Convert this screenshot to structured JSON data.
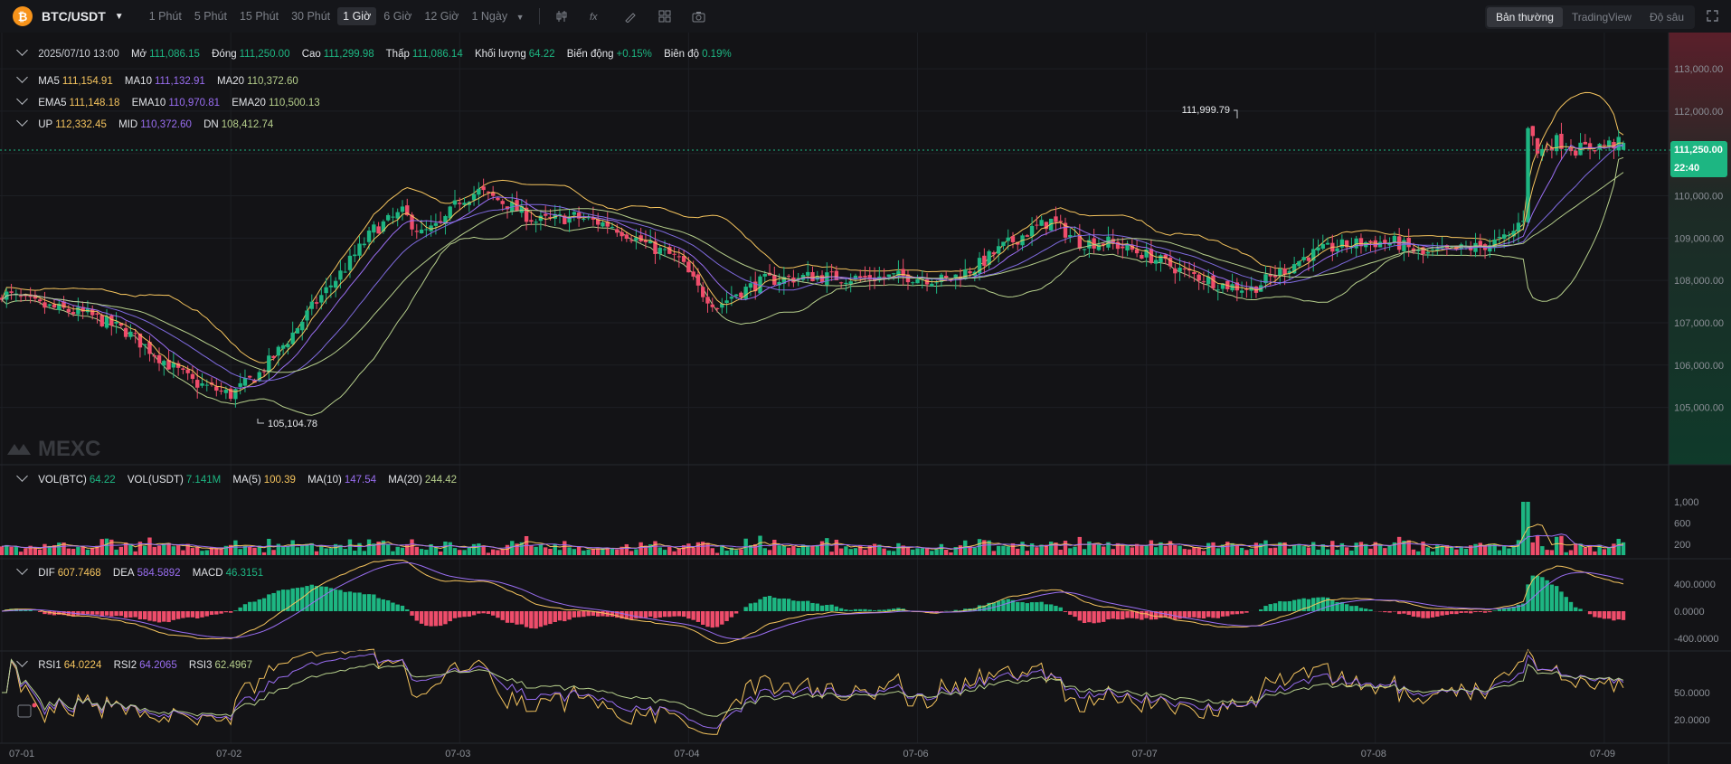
{
  "toolbar": {
    "coin_symbol": "₿",
    "pair": "BTC/USDT",
    "intervals": [
      "1 Phút",
      "5 Phút",
      "15 Phút",
      "30 Phút",
      "1 Giờ",
      "6 Giờ",
      "12 Giờ",
      "1 Ngày"
    ],
    "active_interval": "1 Giờ",
    "views": [
      "Bản thường",
      "TradingView",
      "Độ sâu"
    ],
    "active_view": "Bản thường",
    "icons": [
      "candle-settings-icon",
      "indicator-icon",
      "draw-icon",
      "layout-icon",
      "camera-icon",
      "fullscreen-icon"
    ]
  },
  "legend": {
    "ohlc": {
      "date": "2025/07/10 13:00",
      "open_label": "Mở",
      "open": "111,086.15",
      "close_label": "Đóng",
      "close": "111,250.00",
      "high_label": "Cao",
      "high": "111,299.98",
      "low_label": "Thấp",
      "low": "111,086.14",
      "vol_label": "Khối lượng",
      "vol": "64.22",
      "chg_label": "Biến động",
      "chg": "+0.15%",
      "amp_label": "Biên độ",
      "amp": "0.19%"
    },
    "ma": {
      "ma5_label": "MA5",
      "ma5": "111,154.91",
      "ma10_label": "MA10",
      "ma10": "111,132.91",
      "ma20_label": "MA20",
      "ma20": "110,372.60"
    },
    "ema": {
      "ema5_label": "EMA5",
      "ema5": "111,148.18",
      "ema10_label": "EMA10",
      "ema10": "110,970.81",
      "ema20_label": "EMA20",
      "ema20": "110,500.13"
    },
    "boll": {
      "up_label": "UP",
      "up": "112,332.45",
      "mid_label": "MID",
      "mid": "110,372.60",
      "dn_label": "DN",
      "dn": "108,412.74"
    },
    "vol": {
      "btc_label": "VOL(BTC)",
      "btc": "64.22",
      "usdt_label": "VOL(USDT)",
      "usdt": "7.141M",
      "ma5_label": "MA(5)",
      "ma5": "100.39",
      "ma10_label": "MA(10)",
      "ma10": "147.54",
      "ma20_label": "MA(20)",
      "ma20": "244.42"
    },
    "macd": {
      "dif_label": "DIF",
      "dif": "607.7468",
      "dea_label": "DEA",
      "dea": "584.5892",
      "macd_label": "MACD",
      "macd": "46.3151"
    },
    "rsi": {
      "rsi1_label": "RSI1",
      "rsi1": "64.0224",
      "rsi2_label": "RSI2",
      "rsi2": "64.2065",
      "rsi3_label": "RSI3",
      "rsi3": "62.4967"
    }
  },
  "watermark": "MEXC",
  "colors": {
    "up": "#1db682",
    "down": "#ef4d6b",
    "ma5": "#f5c45e",
    "ma10": "#9a6ef2",
    "ma20": "#b6cf8c",
    "price_tag": "#1db682"
  },
  "chart_data": {
    "type": "candlestick",
    "x_ticks": [
      "07-01",
      "07-02",
      "07-03",
      "07-04",
      "07-06",
      "07-07",
      "07-08",
      "07-09"
    ],
    "y_ticks": [
      "113,000.00",
      "112,000.00",
      "110,000.00",
      "109,000.00",
      "108,000.00",
      "107,000.00",
      "106,000.00",
      "105,000.00"
    ],
    "ylim": [
      104500,
      113600
    ],
    "high_marker": "111,999.79",
    "low_marker": "105,104.78",
    "last_price": "111,250.00",
    "countdown": "22:40",
    "price_path": [
      [
        0,
        107700
      ],
      [
        8,
        107400
      ],
      [
        18,
        107200
      ],
      [
        26,
        106800
      ],
      [
        34,
        106100
      ],
      [
        40,
        105600
      ],
      [
        48,
        105300
      ],
      [
        54,
        105800
      ],
      [
        60,
        106600
      ],
      [
        66,
        107500
      ],
      [
        72,
        108300
      ],
      [
        78,
        109200
      ],
      [
        84,
        109600
      ],
      [
        88,
        109100
      ],
      [
        92,
        109300
      ],
      [
        96,
        109900
      ],
      [
        100,
        110100
      ],
      [
        106,
        109800
      ],
      [
        112,
        109400
      ],
      [
        120,
        109500
      ],
      [
        128,
        109300
      ],
      [
        136,
        108800
      ],
      [
        142,
        108500
      ],
      [
        146,
        107800
      ],
      [
        150,
        107400
      ],
      [
        154,
        107700
      ],
      [
        160,
        108000
      ],
      [
        170,
        108100
      ],
      [
        180,
        108050
      ],
      [
        190,
        108100
      ],
      [
        198,
        108000
      ],
      [
        204,
        108300
      ],
      [
        210,
        108800
      ],
      [
        216,
        109200
      ],
      [
        220,
        109400
      ],
      [
        226,
        108900
      ],
      [
        232,
        108900
      ],
      [
        240,
        108600
      ],
      [
        248,
        108200
      ],
      [
        256,
        107900
      ],
      [
        262,
        107800
      ],
      [
        268,
        108200
      ],
      [
        274,
        108600
      ],
      [
        280,
        108800
      ],
      [
        286,
        108900
      ],
      [
        292,
        108900
      ],
      [
        298,
        108600
      ],
      [
        304,
        108700
      ],
      [
        310,
        108800
      ],
      [
        316,
        109000
      ],
      [
        319,
        109500
      ],
      [
        320,
        111700
      ],
      [
        322,
        111000
      ],
      [
        326,
        111300
      ],
      [
        330,
        111100
      ],
      [
        336,
        111200
      ],
      [
        340,
        111250
      ]
    ],
    "vol_y_ticks": [
      "1,000",
      "600",
      "200"
    ],
    "macd_y_ticks": [
      "400.0000",
      "0.0000",
      "-400.0000"
    ],
    "rsi_y_ticks": [
      "50.0000",
      "20.0000"
    ]
  }
}
